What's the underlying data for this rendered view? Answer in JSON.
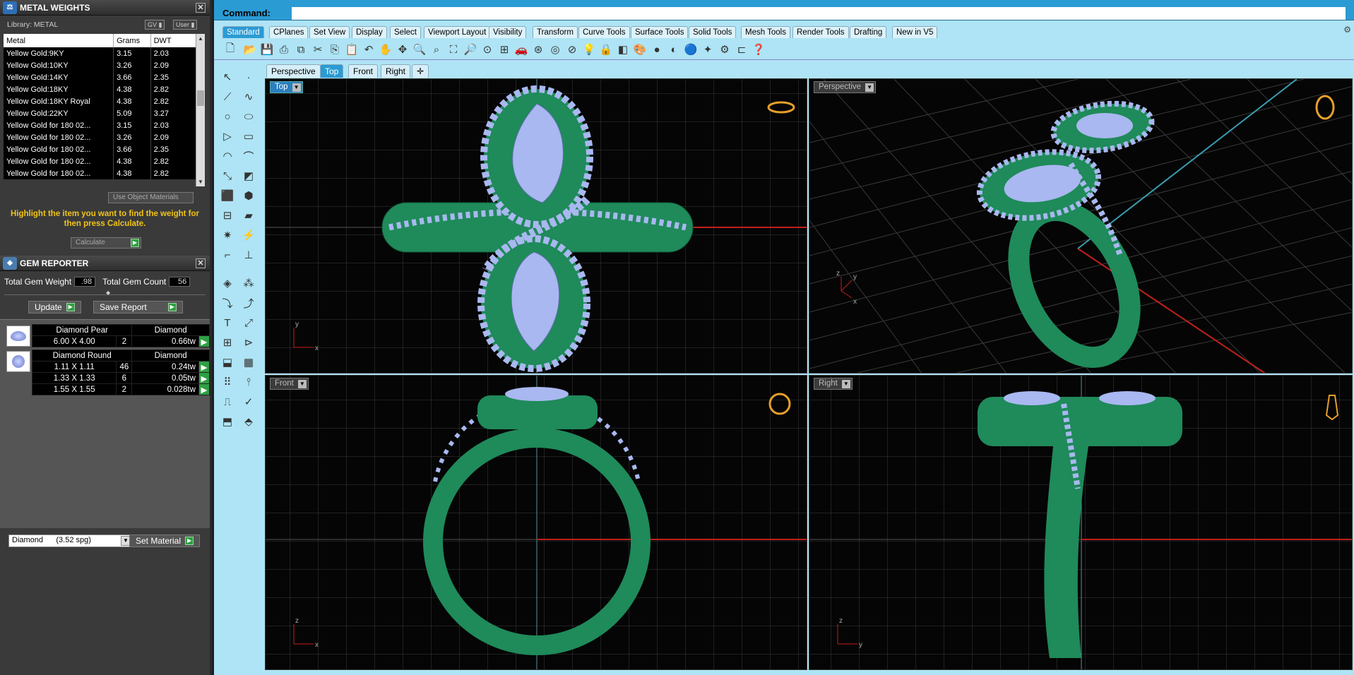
{
  "metal_weights": {
    "title": "METAL WEIGHTS",
    "library_label": "Library: METAL",
    "gv_label": "GV",
    "user_label": "User",
    "columns": [
      "Metal",
      "Grams",
      "DWT"
    ],
    "rows": [
      [
        "Yellow Gold:9KY",
        "3.15",
        "2.03"
      ],
      [
        "Yellow Gold:10KY",
        "3.26",
        "2.09"
      ],
      [
        "Yellow Gold:14KY",
        "3.66",
        "2.35"
      ],
      [
        "Yellow Gold:18KY",
        "4.38",
        "2.82"
      ],
      [
        "Yellow Gold:18KY Royal",
        "4.38",
        "2.82"
      ],
      [
        "Yellow Gold:22KY",
        "5.09",
        "3.27"
      ],
      [
        "Yellow Gold for 180 02...",
        "3.15",
        "2.03"
      ],
      [
        "Yellow Gold for 180 02...",
        "3.26",
        "2.09"
      ],
      [
        "Yellow Gold for 180 02...",
        "3.66",
        "2.35"
      ],
      [
        "Yellow Gold for 180 02...",
        "4.38",
        "2.82"
      ],
      [
        "Yellow Gold for 180 02...",
        "4.38",
        "2.82"
      ]
    ],
    "use_object_materials": "Use Object Materials",
    "hint": "Highlight the item you want to find the weight for then press Calculate.",
    "calculate_label": "Calculate"
  },
  "gem_reporter": {
    "title": "GEM REPORTER",
    "total_weight_label": "Total Gem Weight",
    "total_weight_value": ".98",
    "total_count_label": "Total Gem Count",
    "total_count_value": "56",
    "update_label": "Update",
    "save_report_label": "Save Report",
    "groups": [
      {
        "shape": "Diamond Pear",
        "material": "Diamond",
        "rows": [
          [
            "6.00 X 4.00",
            "2",
            "0.66tw"
          ]
        ]
      },
      {
        "shape": "Diamond Round",
        "material": "Diamond",
        "rows": [
          [
            "1.11 X 1.11",
            "46",
            "0.24tw"
          ],
          [
            "1.33 X 1.33",
            "6",
            "0.05tw"
          ],
          [
            "1.55 X 1.55",
            "2",
            "0.028tw"
          ]
        ]
      }
    ],
    "material_select": "Diamond      (3.52 spg)",
    "set_material_label": "Set Material"
  },
  "command": {
    "label": "Command:"
  },
  "toolbar_tabs": [
    "Standard",
    "CPlanes",
    "Set View",
    "Display",
    "Select",
    "Viewport Layout",
    "Visibility",
    "Transform",
    "Curve Tools",
    "Surface Tools",
    "Solid Tools",
    "Mesh Tools",
    "Render Tools",
    "Drafting",
    "New in V5"
  ],
  "viewport_tabs": [
    "Perspective",
    "Top",
    "Front",
    "Right"
  ],
  "viewports": {
    "top": {
      "label": "Top",
      "axis_x": "x",
      "axis_y": "y"
    },
    "perspective": {
      "label": "Perspective",
      "axis_x": "x",
      "axis_y": "y",
      "axis_z": "z"
    },
    "front": {
      "label": "Front",
      "axis_x": "x",
      "axis_z": "z"
    },
    "right": {
      "label": "Right",
      "axis_y": "y",
      "axis_z": "z"
    }
  },
  "colors": {
    "metal_green": "#1f8a5a",
    "gem_blue": "#a9b8f0",
    "accent_blue": "#2b9bd4",
    "panel_bg": "#aee4f5"
  }
}
